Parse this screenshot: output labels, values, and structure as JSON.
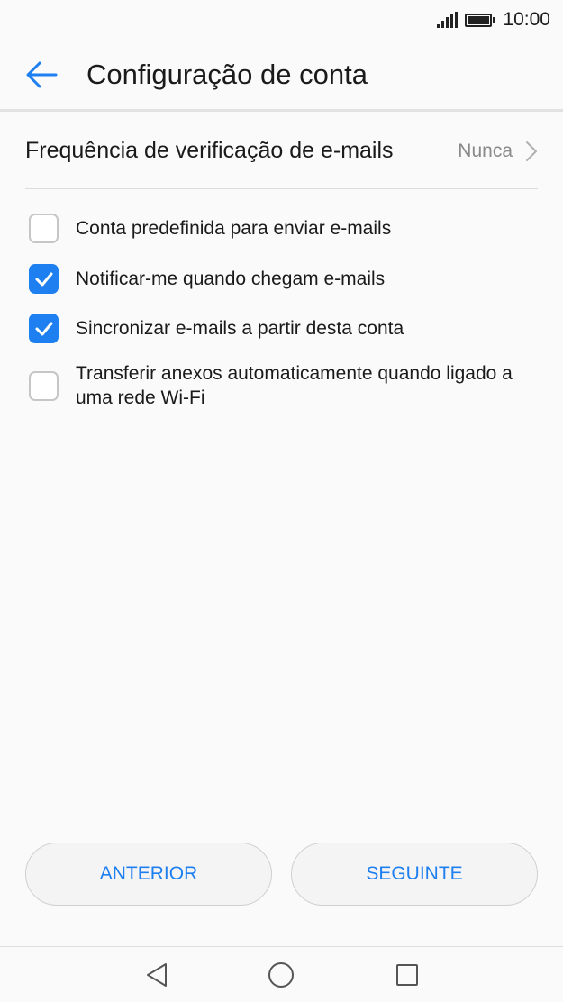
{
  "status": {
    "time": "10:00"
  },
  "header": {
    "title": "Configuração de conta"
  },
  "frequency": {
    "label": "Frequência de verificação de e-mails",
    "value": "Nunca"
  },
  "options": [
    {
      "label": "Conta predefinida para enviar e-mails",
      "checked": false
    },
    {
      "label": "Notificar-me quando chegam e-mails",
      "checked": true
    },
    {
      "label": "Sincronizar e-mails a partir desta conta",
      "checked": true
    },
    {
      "label": "Transferir anexos automaticamente quando ligado a uma rede Wi-Fi",
      "checked": false
    }
  ],
  "buttons": {
    "previous": "ANTERIOR",
    "next": "SEGUINTE"
  },
  "colors": {
    "accent": "#1e7ff0",
    "text": "#1a1a1a",
    "muted": "#8a8a8a"
  },
  "icons": {
    "back": "arrow-left-icon",
    "chevron": "chevron-right-icon",
    "nav_back": "triangle-back-icon",
    "nav_home": "circle-home-icon",
    "nav_recents": "square-recents-icon"
  }
}
